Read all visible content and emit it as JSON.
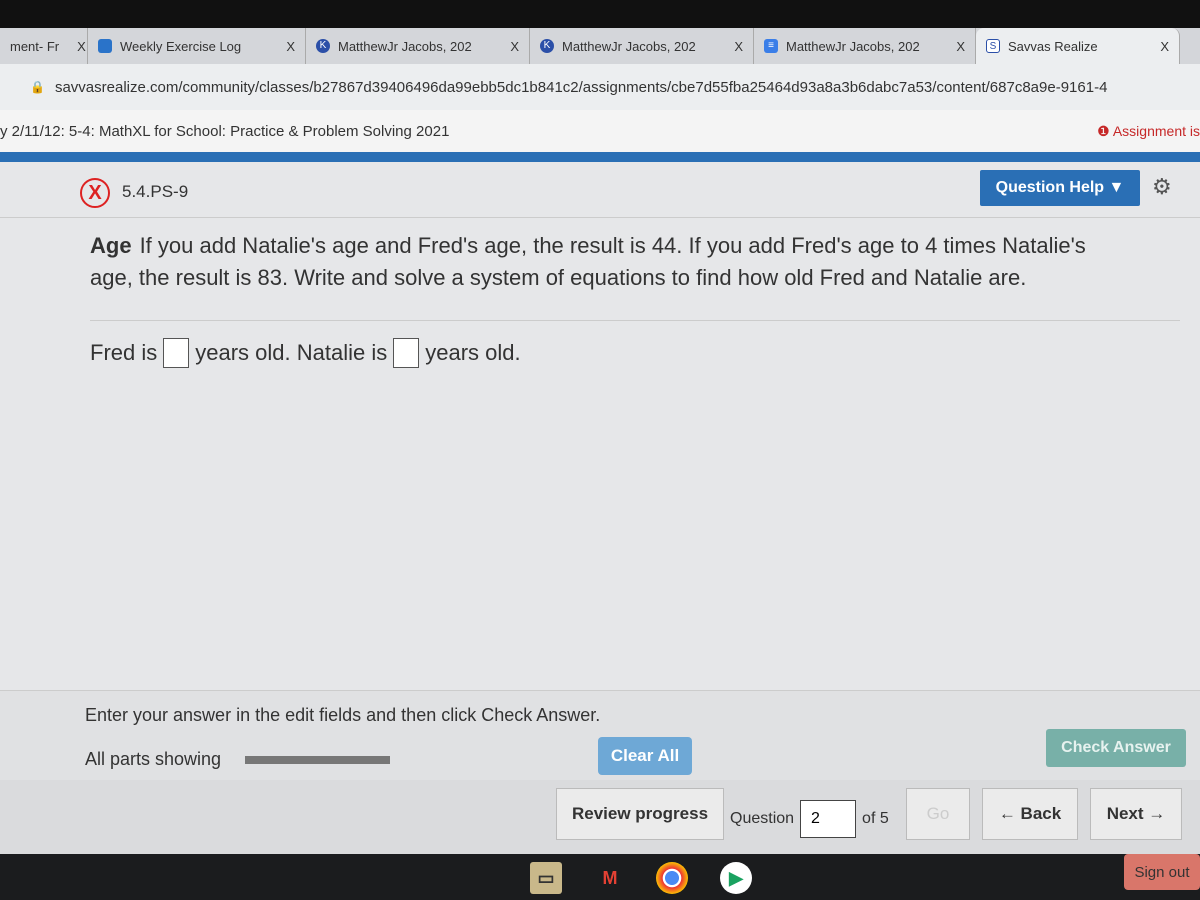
{
  "browser": {
    "tabs": [
      {
        "label": "ment- Fr",
        "icon": "page-icon"
      },
      {
        "label": "Weekly Exercise Log",
        "icon": "classroom-icon"
      },
      {
        "label": "MatthewJr Jacobs, 202",
        "icon": "k-icon"
      },
      {
        "label": "MatthewJr Jacobs, 202",
        "icon": "k-icon"
      },
      {
        "label": "MatthewJr Jacobs, 202",
        "icon": "docs-icon"
      },
      {
        "label": "Savvas Realize",
        "icon": "savvas-icon"
      }
    ],
    "close": "X",
    "url": "savvasrealize.com/community/classes/b27867d39406496da99ebb5dc1b841c2/assignments/cbe7d55fba25464d93a8a3b6dabc7a53/content/687c8a9e-9161-4"
  },
  "assignment": {
    "title": "y 2/11/12: 5-4: MathXL for School: Practice & Problem Solving 2021",
    "warning": "Assignment is"
  },
  "question": {
    "status": "X",
    "id": "5.4.PS-9",
    "help_label": "Question Help ▼",
    "lead": "Age",
    "text": "If you add Natalie's age and Fred's age, the result is 44. If you add Fred's age to 4 times Natalie's age, the result is 83. Write and solve a system of equations to find how old Fred and Natalie are.",
    "answer_parts": [
      "Fred is",
      "years old. Natalie is",
      "years old."
    ],
    "fred_value": "",
    "natalie_value": ""
  },
  "footer": {
    "instruction": "Enter your answer in the edit fields and then click Check Answer.",
    "all_parts": "All parts showing",
    "clear_all": "Clear All",
    "check_answer": "Check Answer",
    "review_progress": "Review progress",
    "question_label": "Question",
    "question_number": "2",
    "of_total": "of 5",
    "go": "Go",
    "back": "← Back",
    "next": "Next →"
  },
  "shelf": {
    "sign_out": "Sign out",
    "apps": [
      "files-icon",
      "gmail-icon",
      "chrome-icon",
      "play-store-icon"
    ]
  },
  "colors": {
    "accent": "#2a6fb5",
    "check": "#78b0a8",
    "error": "#d22222"
  }
}
